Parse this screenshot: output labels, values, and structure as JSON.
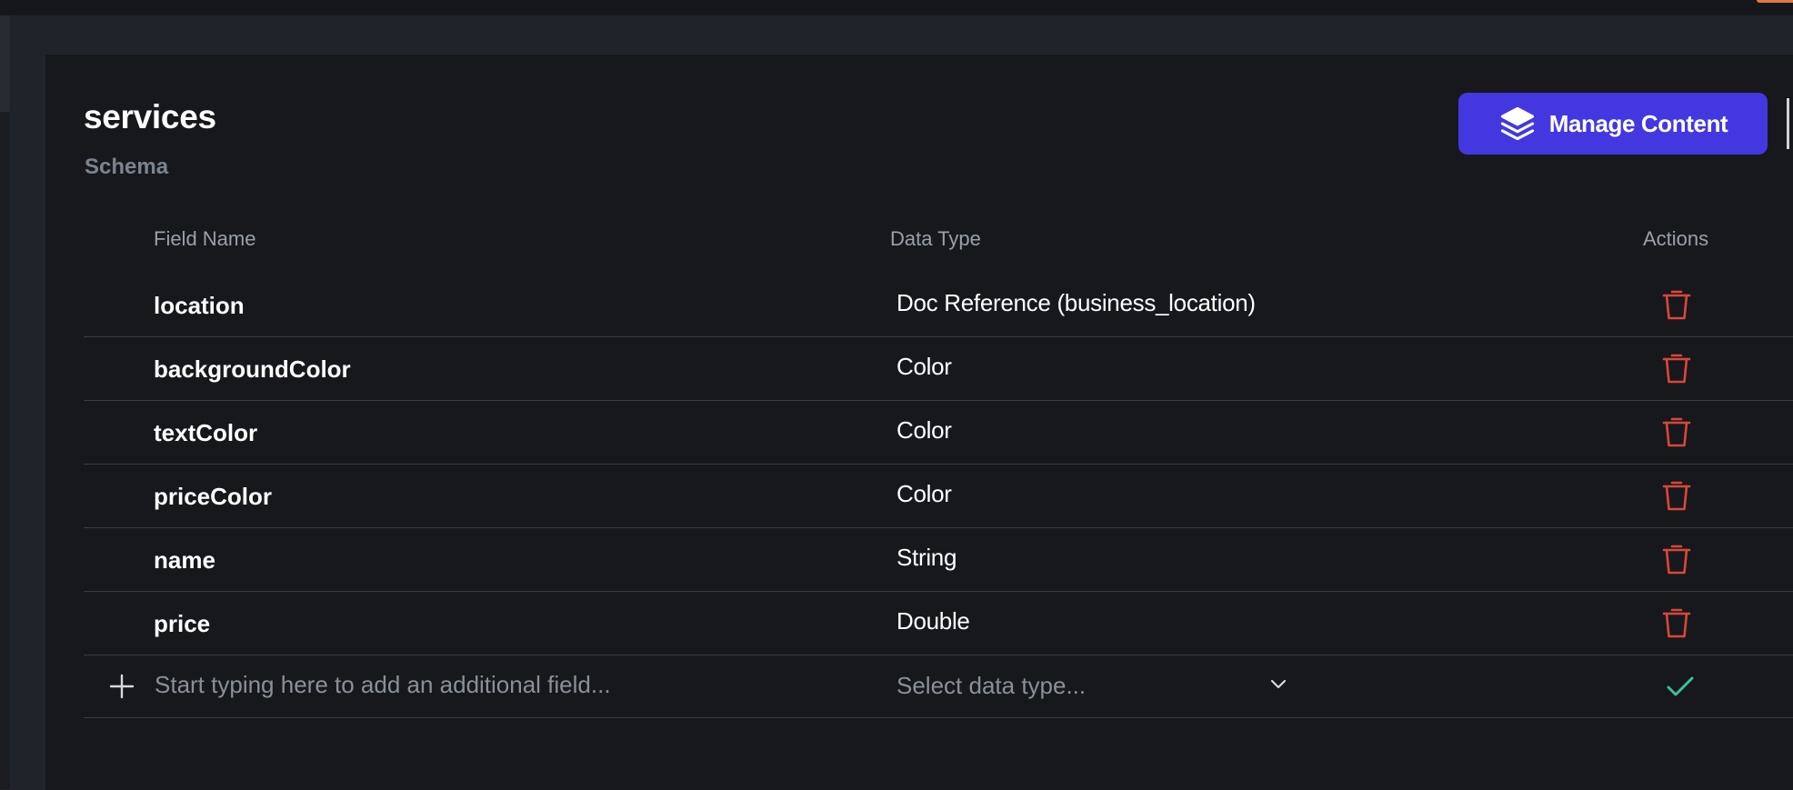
{
  "collection": {
    "title": "services",
    "subtitle": "Schema"
  },
  "toolbar": {
    "manage_label": "Manage Content",
    "manage_icon": "layers-icon"
  },
  "table": {
    "headers": {
      "field_name": "Field Name",
      "data_type": "Data Type",
      "actions": "Actions"
    },
    "rows": [
      {
        "name": "location",
        "type": "Doc Reference (business_location)"
      },
      {
        "name": "backgroundColor",
        "type": "Color"
      },
      {
        "name": "textColor",
        "type": "Color"
      },
      {
        "name": "priceColor",
        "type": "Color"
      },
      {
        "name": "name",
        "type": "String"
      },
      {
        "name": "price",
        "type": "Double"
      }
    ]
  },
  "add_field": {
    "placeholder": "Start typing here to add an additional field...",
    "type_placeholder": "Select data type..."
  },
  "colors": {
    "accent": "#4338e0",
    "delete": "#d9473b",
    "confirm": "#3dbf9e"
  }
}
